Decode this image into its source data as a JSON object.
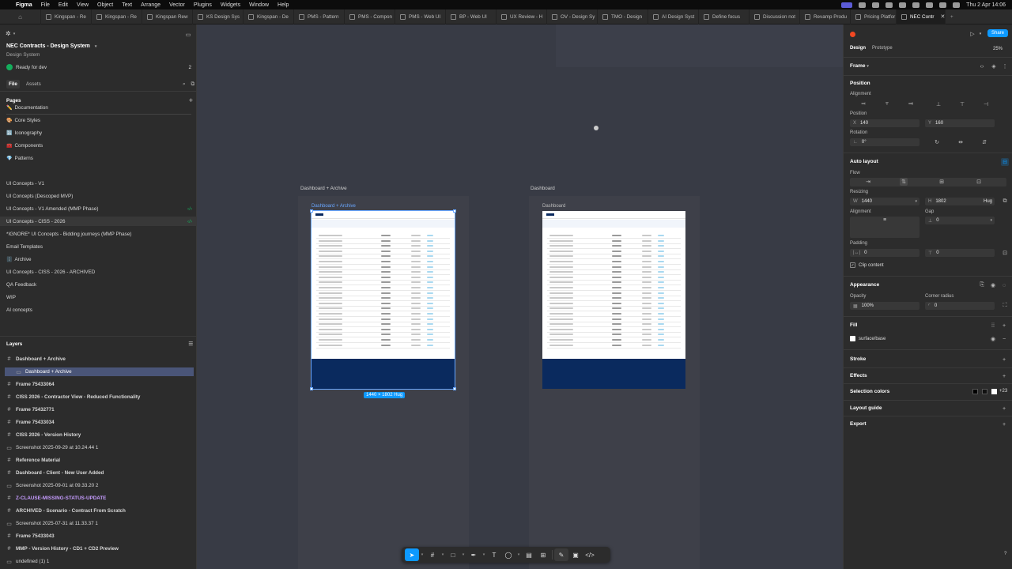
{
  "menubar": {
    "app": "Figma",
    "items": [
      "File",
      "Edit",
      "View",
      "Object",
      "Text",
      "Arrange",
      "Vector",
      "Plugins",
      "Widgets",
      "Window",
      "Help"
    ],
    "clock": "Thu 2 Apr  14:06"
  },
  "tabs": [
    {
      "label": "Kingspan - Re"
    },
    {
      "label": "Kingspan - Re"
    },
    {
      "label": "Kingspan Rew"
    },
    {
      "label": "KS Design Sys"
    },
    {
      "label": "Kingspan - De"
    },
    {
      "label": "PMS - Pattern"
    },
    {
      "label": "PMS - Compon"
    },
    {
      "label": "PMS - Web UI"
    },
    {
      "label": "BP - Web UI"
    },
    {
      "label": "UX Review - H"
    },
    {
      "label": "OV - Design Sy"
    },
    {
      "label": "TMO - Design"
    },
    {
      "label": "AI Design Syst"
    },
    {
      "label": "Define focus"
    },
    {
      "label": "Discussion not"
    },
    {
      "label": "Revamp Produ"
    },
    {
      "label": "Pricing Platfor"
    },
    {
      "label": "NEC Contr"
    }
  ],
  "left": {
    "file_title": "NEC Contracts - Design System",
    "file_sub": "Design System",
    "ready_label": "Ready for dev",
    "ready_count": "2",
    "tab_file": "File",
    "tab_assets": "Assets",
    "pages_heading": "Pages",
    "pages": [
      {
        "emoji": "✏️",
        "label": "Documentation"
      },
      {
        "emoji": "🎨",
        "label": "Core Styles"
      },
      {
        "emoji": "🔣",
        "label": "Iconography"
      },
      {
        "emoji": "🧰",
        "label": "Components"
      },
      {
        "emoji": "💎",
        "label": "Patterns"
      },
      {
        "emoji": "",
        "label": "UI Concepts - V1"
      },
      {
        "emoji": "",
        "label": "UI Concepts (Descoped MVP)"
      },
      {
        "emoji": "",
        "label": "UI Concepts - V1 Amended (MMP Phase)"
      },
      {
        "emoji": "",
        "label": "UI Concepts - CISS - 2026"
      },
      {
        "emoji": "",
        "label": "*IGNORE* UI Concepts - Bidding journeys (MMP Phase)"
      },
      {
        "emoji": "",
        "label": "Email Templates"
      },
      {
        "emoji": "🗄️",
        "label": "Archive"
      },
      {
        "emoji": "",
        "label": "UI Concepts - CISS - 2026 - ARCHIVED"
      },
      {
        "emoji": "",
        "label": "QA Feedback"
      },
      {
        "emoji": "",
        "label": "WIP"
      },
      {
        "emoji": "",
        "label": "AI concepts"
      }
    ],
    "layers_heading": "Layers",
    "layers": [
      {
        "label": "Dashboard + Archive",
        "bold": true
      },
      {
        "label": "Dashboard + Archive",
        "bold": false,
        "selected": true
      },
      {
        "label": "Frame 75433064",
        "bold": true
      },
      {
        "label": "CISS 2026 - Contractor View - Reduced Functionality",
        "bold": true
      },
      {
        "label": "Frame 75432771",
        "bold": true
      },
      {
        "label": "Frame 75433034",
        "bold": true
      },
      {
        "label": "CISS 2026 - Version History",
        "bold": true
      },
      {
        "label": "Screenshot 2025-09-29 at 10.24.44 1",
        "bold": false
      },
      {
        "label": "Reference Material",
        "bold": true
      },
      {
        "label": "Dashboard - Client - New User Added",
        "bold": true
      },
      {
        "label": "Screenshot 2025-09-01 at 09.33.20 2",
        "bold": false
      },
      {
        "label": "Z-CLAUSE-MISSING-STATUS-UPDATE",
        "bold": true,
        "purple": true
      },
      {
        "label": "ARCHIVED - Scenario - Contract From Scratch",
        "bold": true
      },
      {
        "label": "Screenshot 2025-07-31 at 11.33.37 1",
        "bold": false
      },
      {
        "label": "Frame 75433043",
        "bold": true
      },
      {
        "label": "MMP - Version History - CD1 + CD2 Preview",
        "bold": true
      },
      {
        "label": "undefined (1) 1",
        "bold": false
      }
    ]
  },
  "canvas": {
    "frame1_label": "Dashboard + Archive",
    "frame1_inner_label": "Dashboard + Archive",
    "frame2_label": "Dashboard",
    "frame2_inner_label": "Dashboard",
    "size_badge": "1440 × 1802 Hug"
  },
  "right": {
    "share": "Share",
    "zoom": "25%",
    "tab_design": "Design",
    "tab_prototype": "Prototype",
    "frame_label": "Frame",
    "position_heading": "Position",
    "alignment_label": "Alignment",
    "position_label": "Position",
    "x_label": "X",
    "x_value": "140",
    "y_label": "Y",
    "y_value": "160",
    "rotation_label": "Rotation",
    "rotation_value": "0°",
    "auto_layout_heading": "Auto layout",
    "flow_label": "Flow",
    "resizing_label": "Resizing",
    "w_label": "W",
    "w_value": "1440",
    "h_label": "H",
    "h_value": "1802",
    "h_mode": "Hug",
    "al_alignment_label": "Alignment",
    "gap_label": "Gap",
    "gap_value": "0",
    "padding_label": "Padding",
    "pad_h": "0",
    "pad_v": "0",
    "clip_content": "Clip content",
    "appearance_heading": "Appearance",
    "opacity_label": "Opacity",
    "opacity_value": "100%",
    "corner_label": "Corner radius",
    "corner_value": "0",
    "fill_heading": "Fill",
    "fill_value": "surface/base",
    "stroke_heading": "Stroke",
    "effects_heading": "Effects",
    "selection_colors_heading": "Selection colors",
    "selection_more": "+23",
    "layout_guide_heading": "Layout guide",
    "export_heading": "Export",
    "help": "?"
  },
  "colors": {
    "accent": "#0d99ff",
    "selection_frame": "#6aa7ff",
    "footer_navy": "#0a2a5e"
  }
}
